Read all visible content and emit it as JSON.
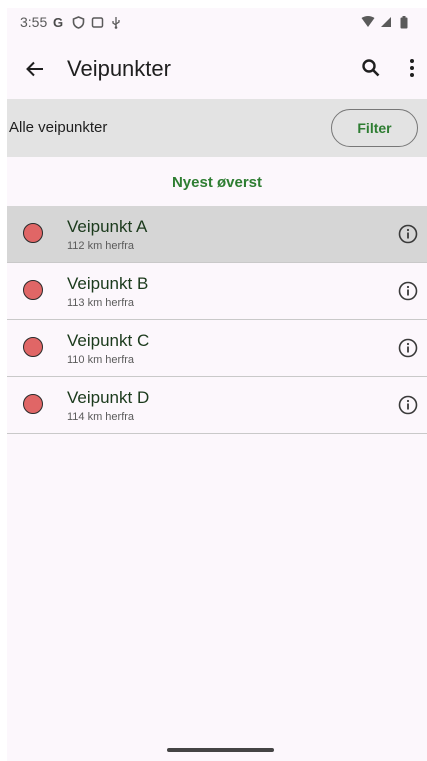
{
  "status_bar": {
    "time": "3:55",
    "icons": [
      "google-icon",
      "shield-icon",
      "screen-icon",
      "usb-icon",
      "wifi-icon",
      "signal-icon",
      "battery-icon"
    ]
  },
  "app_bar": {
    "title": "Veipunkter",
    "icons": [
      "back-arrow-icon",
      "search-icon",
      "more-vert-icon"
    ]
  },
  "filter_bar": {
    "label": "Alle veipunkter",
    "button_label": "Filter"
  },
  "sort": {
    "label": "Nyest øverst"
  },
  "waypoints": [
    {
      "name": "Veipunkt A",
      "distance": "112 km herfra"
    },
    {
      "name": "Veipunkt B",
      "distance": "113 km herfra"
    },
    {
      "name": "Veipunkt C",
      "distance": "110 km herfra"
    },
    {
      "name": "Veipunkt D",
      "distance": "114 km herfra"
    }
  ],
  "colors": {
    "accent": "#2e7d32",
    "marker": "#e06666",
    "selected_row": "#d6d6d6",
    "filter_bar": "#e3e3e3",
    "background": "#fcf7fc"
  }
}
